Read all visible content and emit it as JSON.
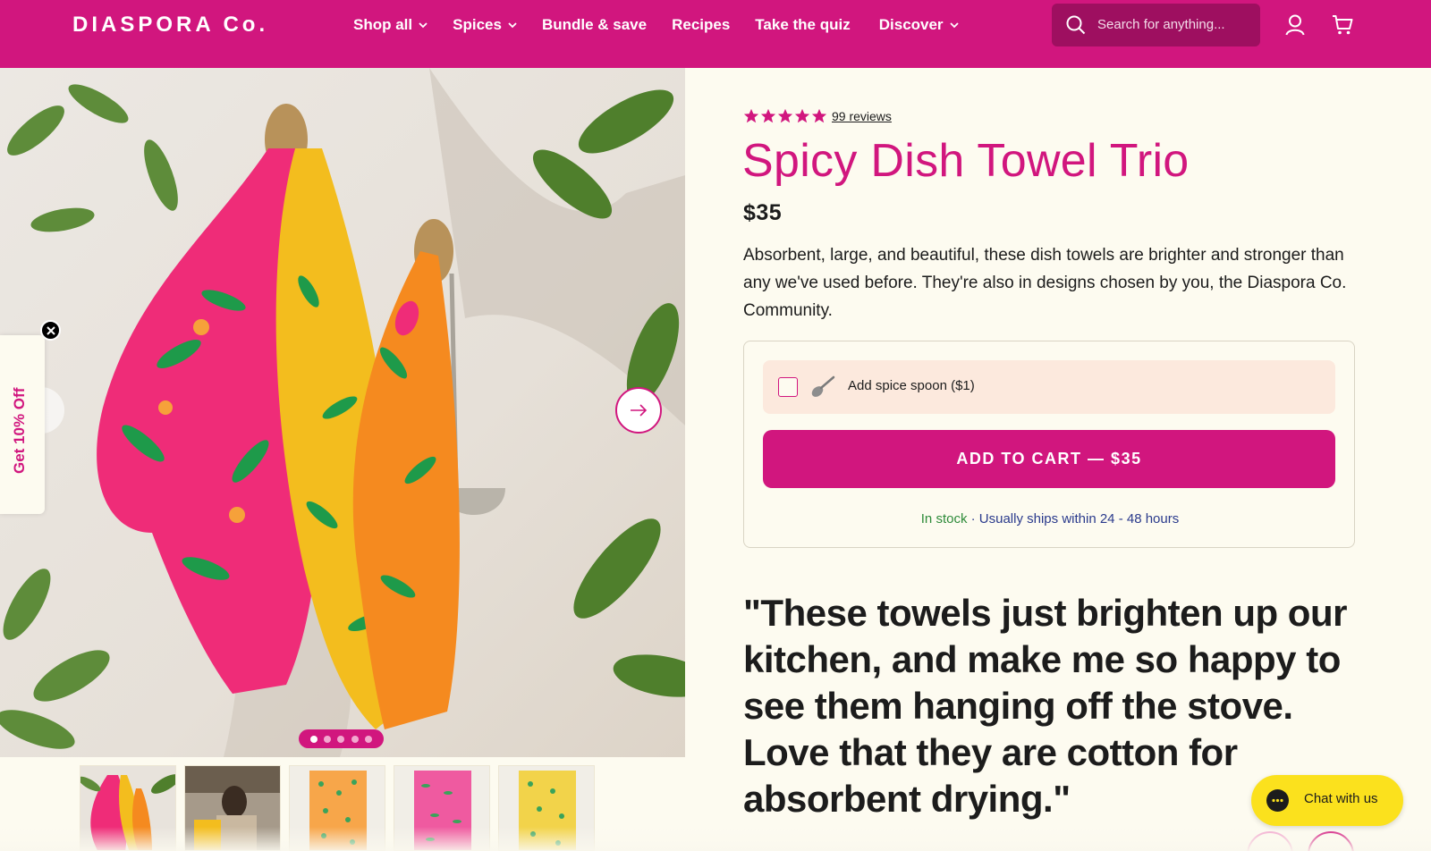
{
  "header": {
    "logo": "DIASPORA Co.",
    "nav": [
      {
        "label": "Shop all",
        "dropdown": true
      },
      {
        "label": "Spices",
        "dropdown": true
      },
      {
        "label": "Bundle & save",
        "dropdown": false
      },
      {
        "label": "Recipes",
        "dropdown": false
      },
      {
        "label": "Take the quiz",
        "dropdown": false
      },
      {
        "label": "Discover",
        "dropdown": true
      }
    ],
    "search_placeholder": "Search for anything...",
    "brand_color": "#d1167e"
  },
  "gallery": {
    "slide_count": 5,
    "active_slide": 1,
    "thumbnail_count": 5
  },
  "discount_tab": {
    "label": "Get 10% Off"
  },
  "product": {
    "rating": 5,
    "reviews_label": "99 reviews",
    "title": "Spicy Dish Towel Trio",
    "price": "$35",
    "description": "Absorbent, large, and beautiful, these dish towels are brighter and stronger than any we've used before. They're also in designs chosen by you, the Diaspora Co. Community.",
    "addon_label": "Add spice spoon ($1)",
    "addon_checked": false,
    "add_to_cart_label": "ADD TO CART — $35",
    "stock_status": "In stock",
    "shipping_note": "· Usually ships within 24 - 48 hours"
  },
  "quote": "\"These towels just brighten up our kitchen, and make me so happy to see them hanging off the stove. Love that they are cotton for absorbent drying.\"",
  "chat": {
    "label": "Chat with us"
  }
}
